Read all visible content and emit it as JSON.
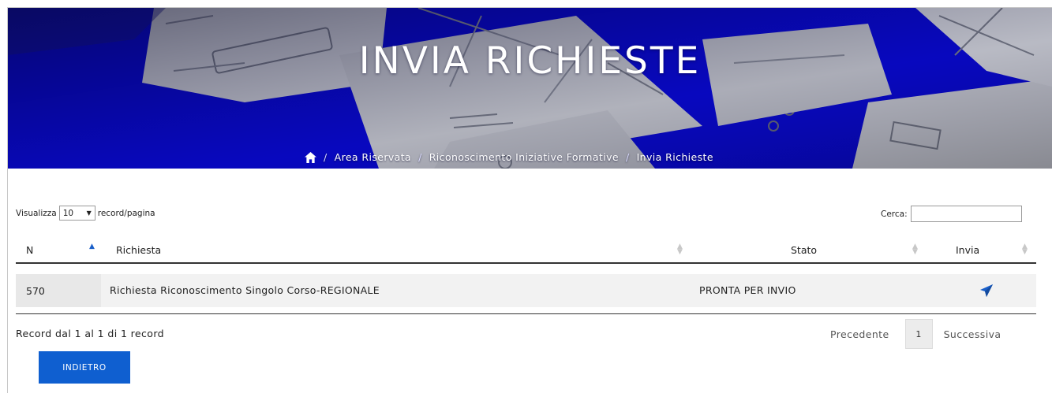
{
  "hero": {
    "title": "INVIA RICHIESTE",
    "breadcrumb": {
      "home_icon": "home-icon",
      "items": [
        "Area Riservata",
        "Riconoscimento Iniziative Formative",
        "Invia Richieste"
      ],
      "separator": "/"
    }
  },
  "table_controls": {
    "length_prefix": "Visualizza",
    "length_value": "10",
    "length_suffix": "record/pagina",
    "search_label": "Cerca:",
    "search_value": ""
  },
  "table": {
    "columns": [
      "N",
      "Richiesta",
      "Stato",
      "Invia"
    ],
    "rows": [
      {
        "n": "570",
        "richiesta": "Richiesta Riconoscimento Singolo Corso-REGIONALE",
        "stato": "PRONTA PER INVIO",
        "invia_icon": "send-icon"
      }
    ]
  },
  "footer": {
    "info": "Record dal 1 al 1 di 1 record",
    "prev_label": "Precedente",
    "current_page": "1",
    "next_label": "Successiva",
    "back_button": "INDIETRO"
  },
  "colors": {
    "hero_blue": "#0a0ad8",
    "button_blue": "#0f5fd0",
    "icon_blue": "#1a5fc9"
  }
}
